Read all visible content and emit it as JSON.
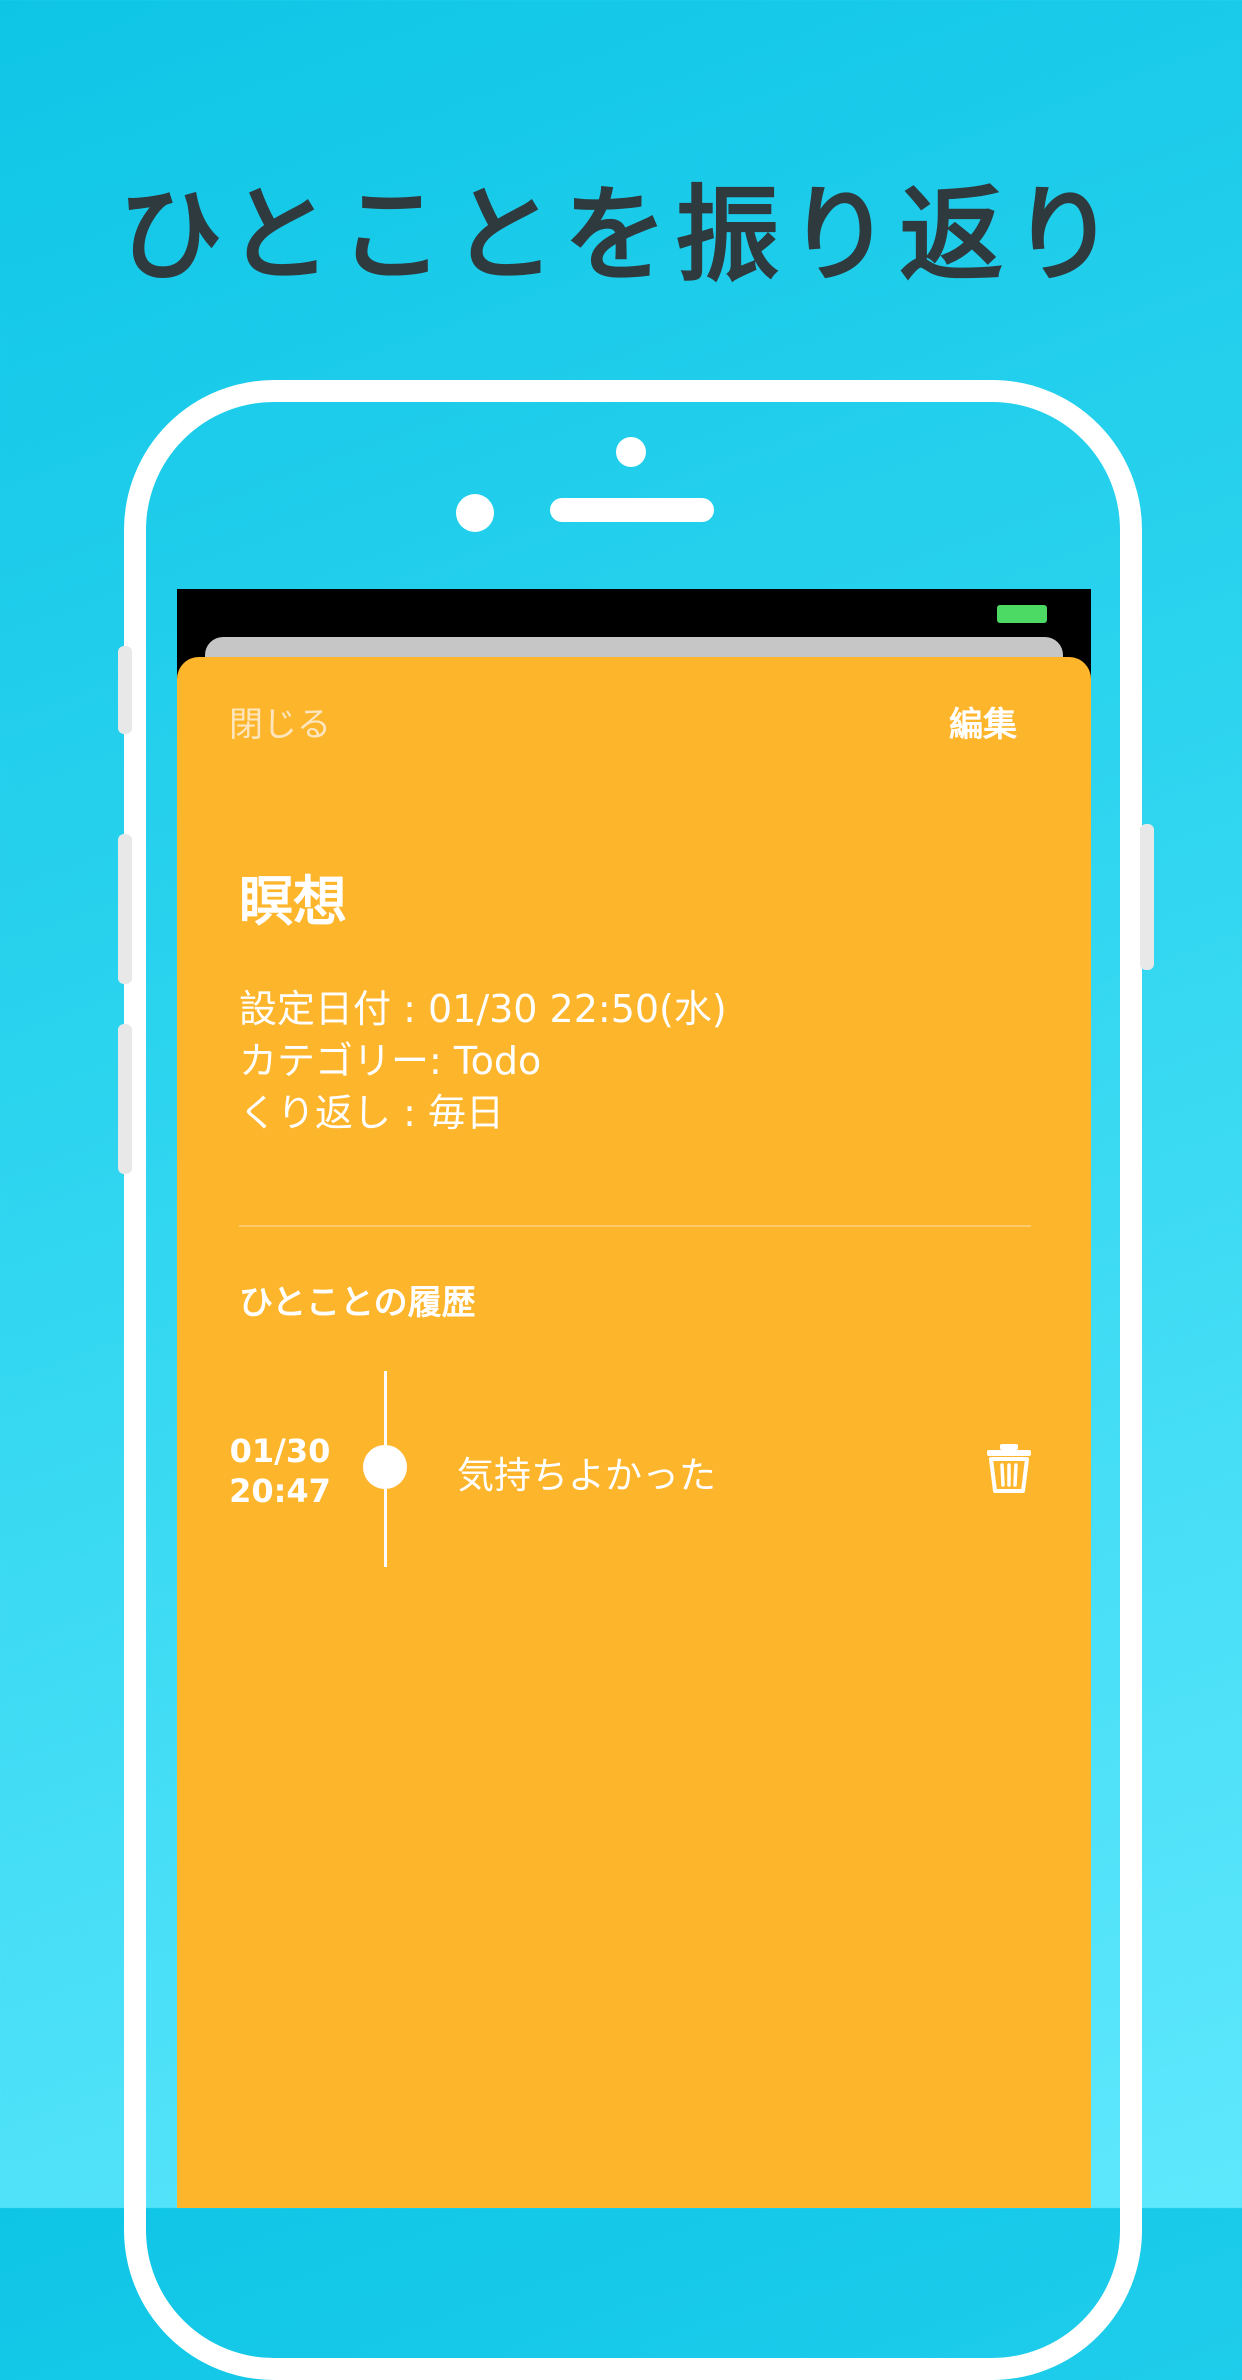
{
  "headline": "ひとことを振り返り",
  "nav": {
    "close_label": "閉じる",
    "edit_label": "編集"
  },
  "task": {
    "title": "瞑想",
    "details": [
      "設定日付 : 01/30 22:50(水)",
      "カテゴリー: Todo",
      "くり返し : 毎日"
    ]
  },
  "history": {
    "heading": "ひとことの履歴",
    "entries": [
      {
        "date": "01/30",
        "time": "20:47",
        "text": "気持ちよかった",
        "delete_icon": "trash-icon"
      }
    ]
  },
  "colors": {
    "background_accent": "#1ecbeb",
    "sheet": "#fdb52c",
    "battery": "#4cd964"
  }
}
